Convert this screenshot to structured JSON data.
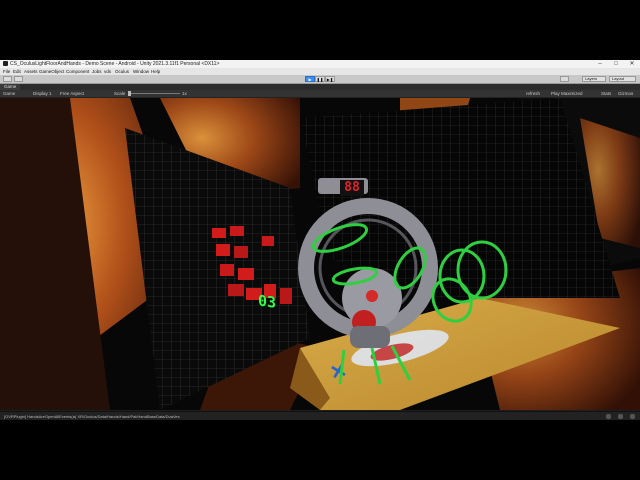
{
  "window": {
    "title": "CS_OculusLightFloorAndHands - Demo Scene - Android - Unity 2021.3.11f1 Personal <DX11>",
    "minimize": "–",
    "maximize": "□",
    "close": "✕"
  },
  "menu": [
    "File",
    "Edit",
    "Assets",
    "GameObject",
    "Component",
    "Jobs",
    "vds",
    "Oculus",
    "Window",
    "Help"
  ],
  "toolbar": {
    "play_icon": "▶",
    "pause_icon": "❚❚",
    "step_icon": "▶❚",
    "layers_label": "Layers",
    "layout_label": "Layout"
  },
  "tab": {
    "label": "Game"
  },
  "game_toolbar": {
    "view_label": "Game",
    "display_label": "Display 1",
    "aspect_label": "Free Aspect",
    "scale_label": "Scale",
    "scale_value": "1x",
    "device_label": "refresh",
    "play_mode_label": "Play Maximized",
    "stats_label": "Stats",
    "gizmos_label": "Gizmos"
  },
  "viewport": {
    "hud_counter": "88",
    "panel_digits": "03"
  },
  "status": {
    "message": "[OVRPlugin] HandsAreOpenAllEvents(a) XR/Oculus/Data/Hands/Hand/Pal/HandBaseData/DuaVes"
  },
  "colors": {
    "accent": "#3d8ef0",
    "hud_red": "#e2202a",
    "ring_green": "#2fd040",
    "digit_green": "#30ff4a",
    "floor_gold": "#d4a440"
  },
  "icons": {
    "play": "play-icon",
    "pause": "pause-icon",
    "step": "step-icon",
    "logo": "unity-logo-icon"
  }
}
